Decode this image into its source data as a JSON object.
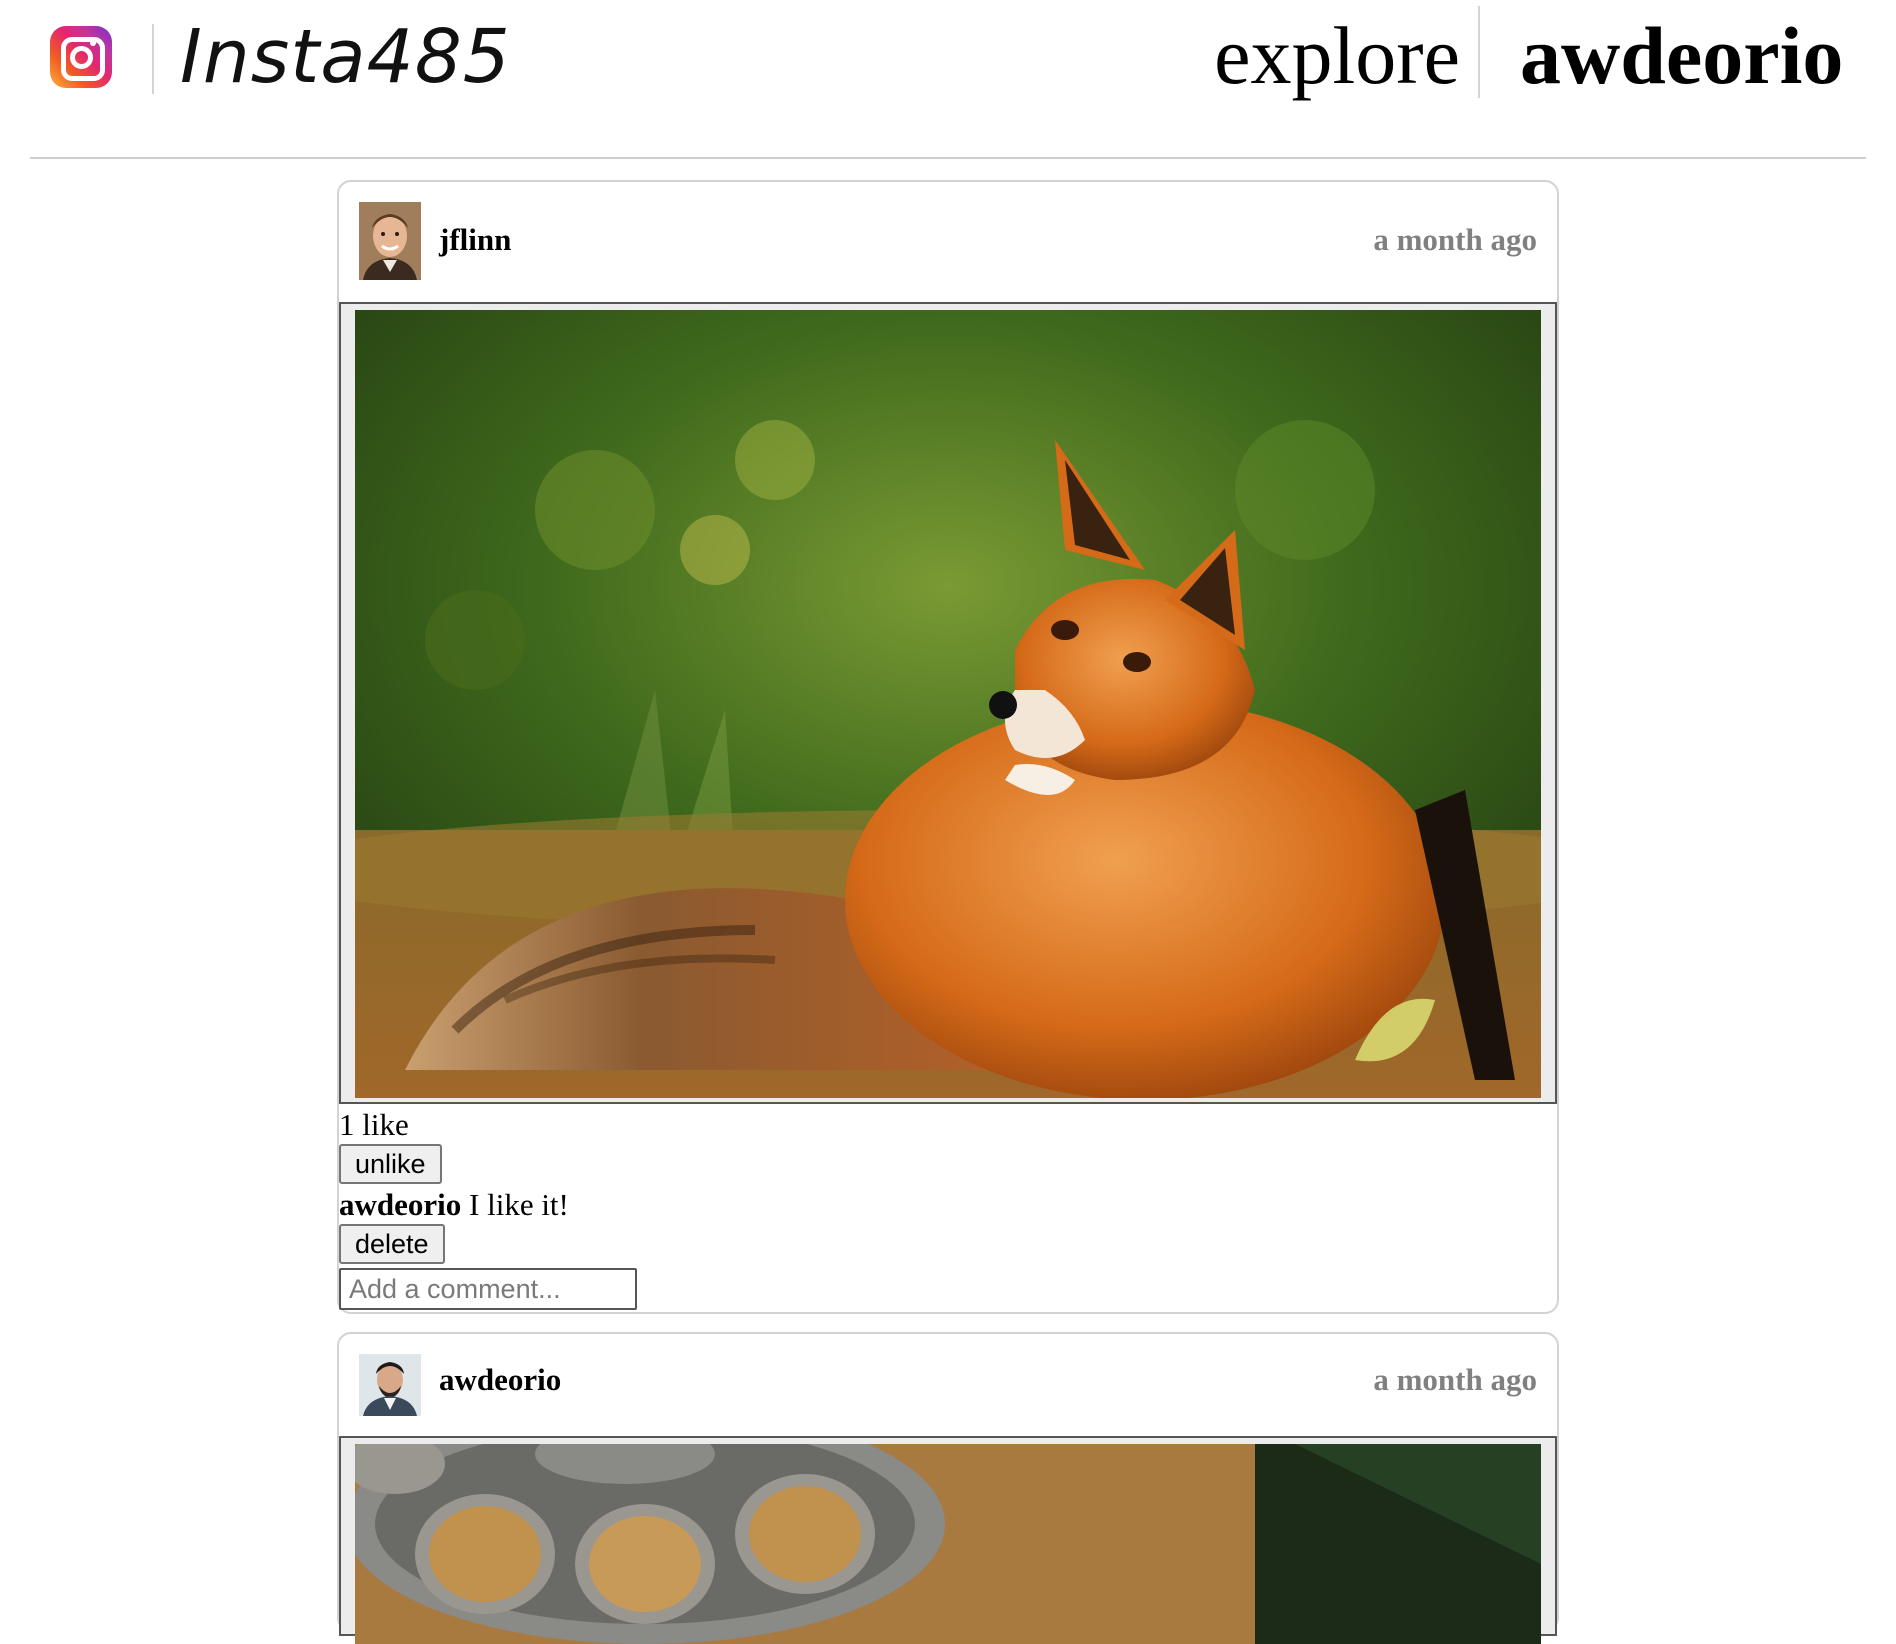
{
  "header": {
    "brand": "Insta485",
    "nav_explore": "explore",
    "nav_user": "awdeorio"
  },
  "posts": [
    {
      "owner": "jflinn",
      "timestamp": "a month ago",
      "likes_text": "1 like",
      "like_button": "unlike",
      "comments": [
        {
          "owner": "awdeorio",
          "text": "I like it!",
          "delete_label": "delete"
        }
      ],
      "comment_placeholder": "Add a comment...",
      "photo_subject": "red fox lying on forest floor"
    },
    {
      "owner": "awdeorio",
      "timestamp": "a month ago",
      "photo_subject": "metal bowls with food pellets on wood shavings"
    }
  ],
  "colors": {
    "timestamp": "#808080",
    "card_border": "#d3d3d3",
    "divider": "#cfcfcf"
  }
}
